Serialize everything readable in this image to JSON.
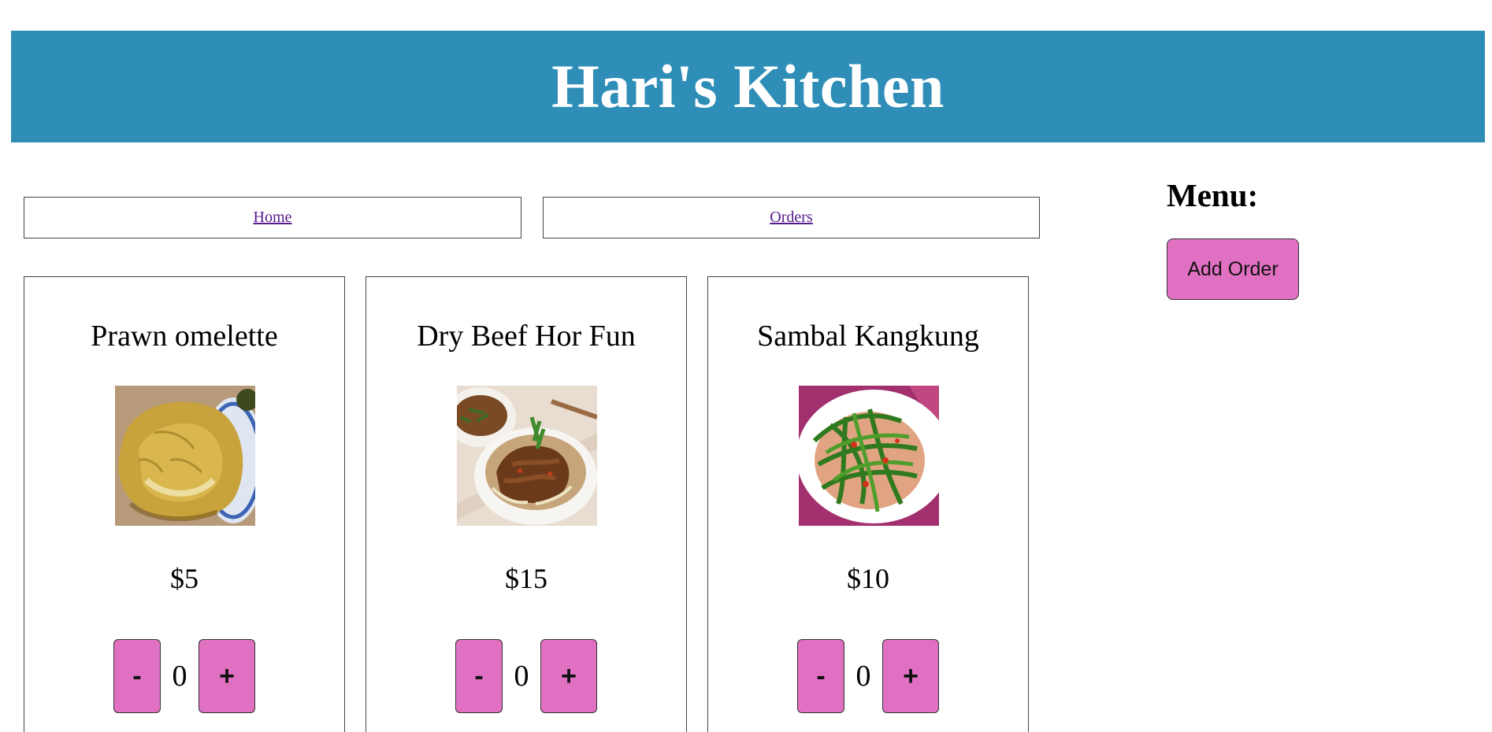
{
  "header": {
    "title": "Hari's Kitchen",
    "background_color": "#2e8eb7"
  },
  "nav": {
    "items": [
      {
        "label": "Home"
      },
      {
        "label": "Orders"
      }
    ]
  },
  "menu": {
    "items": [
      {
        "name": "Prawn omelette",
        "price": "$5",
        "quantity": "0",
        "image": "omelette-photo"
      },
      {
        "name": "Dry Beef Hor Fun",
        "price": "$15",
        "quantity": "0",
        "image": "beef-noodles-photo"
      },
      {
        "name": "Sambal Kangkung",
        "price": "$10",
        "quantity": "0",
        "image": "kangkung-photo"
      }
    ],
    "decrement_label": "-",
    "increment_label": "+"
  },
  "sidebar": {
    "heading": "Menu:",
    "add_order_label": "Add Order",
    "button_color": "#e070c1"
  }
}
